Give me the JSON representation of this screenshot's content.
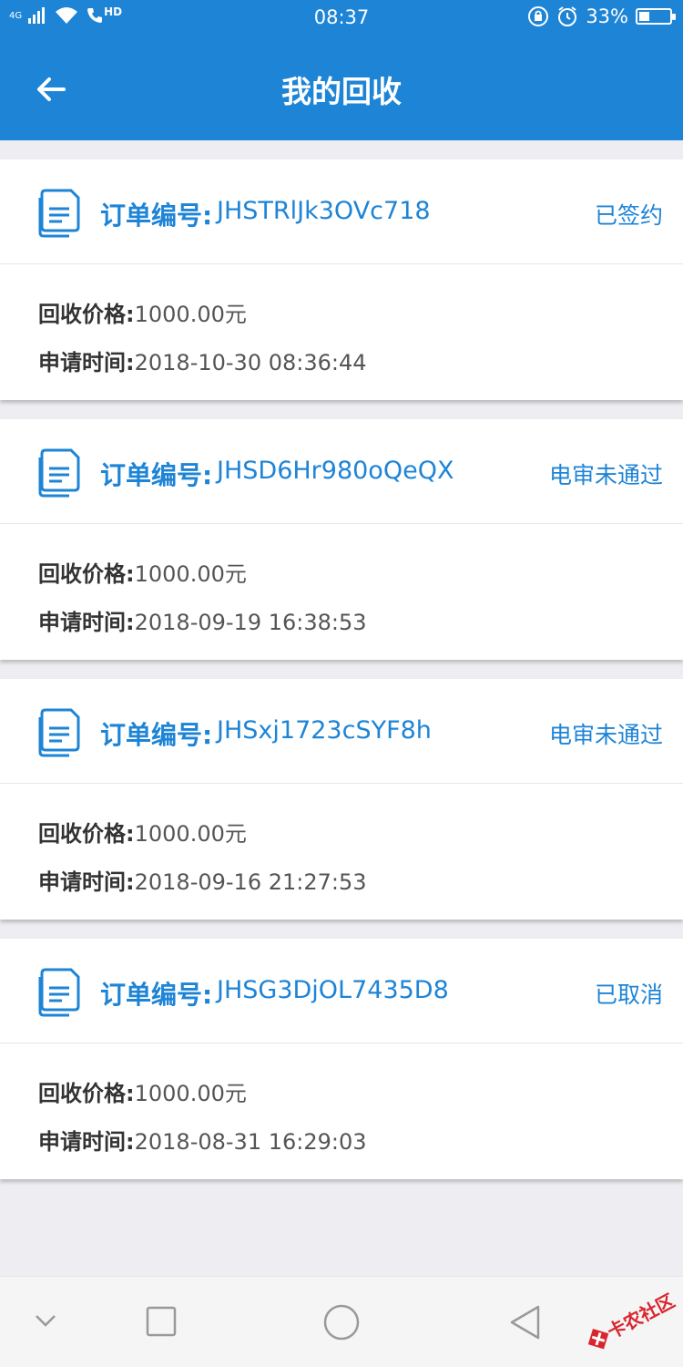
{
  "status_bar": {
    "signal_text": "4G",
    "hd_text": "HD",
    "time": "08:37",
    "battery_percent_text": "33%",
    "battery_level": 0.33
  },
  "header": {
    "title": "我的回收"
  },
  "orders": [
    {
      "order_label": "订单编号:",
      "order_no": "JHSTRlJk3OVc718",
      "status": "已签约",
      "price_label": "回收价格:",
      "price": "1000.00元",
      "time_label": "申请时间:",
      "time": "2018-10-30 08:36:44"
    },
    {
      "order_label": "订单编号:",
      "order_no": "JHSD6Hr980oQeQX",
      "status": "电审未通过",
      "price_label": "回收价格:",
      "price": "1000.00元",
      "time_label": "申请时间:",
      "time": "2018-09-19 16:38:53"
    },
    {
      "order_label": "订单编号:",
      "order_no": "JHSxj1723cSYF8h",
      "status": "电审未通过",
      "price_label": "回收价格:",
      "price": "1000.00元",
      "time_label": "申请时间:",
      "time": "2018-09-16 21:27:53"
    },
    {
      "order_label": "订单编号:",
      "order_no": "JHSG3DjOL7435D8",
      "status": "已取消",
      "price_label": "回收价格:",
      "price": "1000.00元",
      "time_label": "申请时间:",
      "time": "2018-08-31 16:29:03"
    }
  ],
  "watermark": {
    "text": "卡农社区"
  },
  "colors": {
    "primary": "#1e84d6",
    "background": "#eeeef2"
  }
}
